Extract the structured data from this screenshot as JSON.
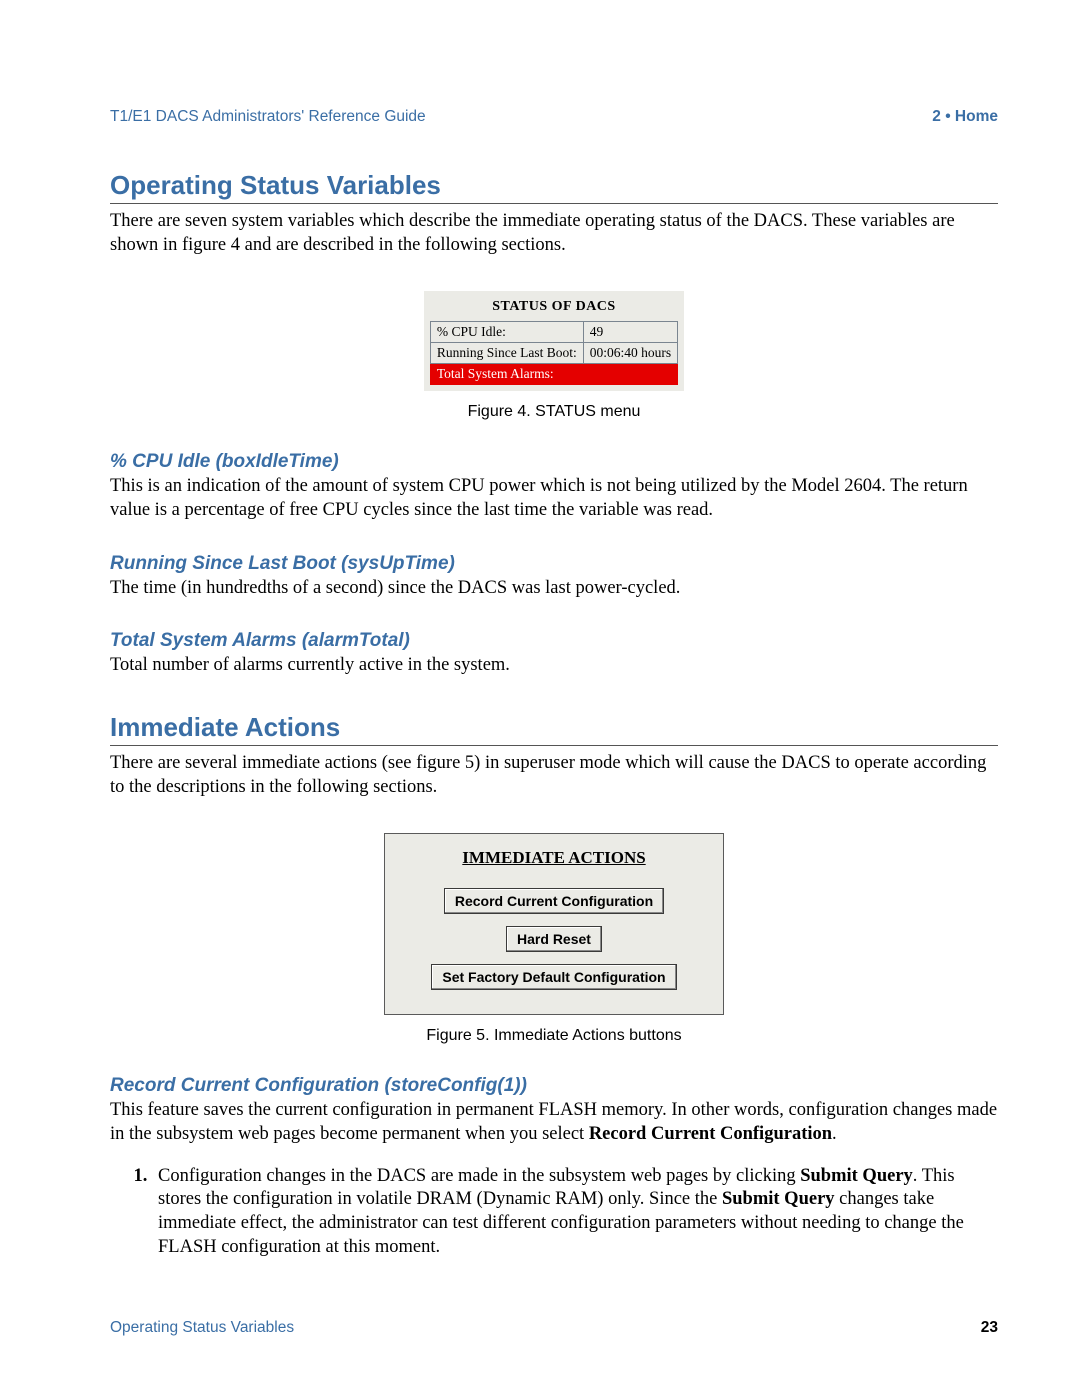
{
  "runhead": {
    "left": "T1/E1 DACS Administrators' Reference Guide",
    "right": "2 • Home"
  },
  "section1": {
    "title": "Operating Status Variables",
    "intro": "There are seven system variables which describe the immediate operating status of the DACS. These variables are shown in figure 4 and are described in the following sections."
  },
  "fig4": {
    "caption": "Figure 4. STATUS menu",
    "panel_title": "STATUS OF DACS",
    "rows": [
      {
        "label": "% CPU Idle:",
        "value": "49"
      },
      {
        "label": "Running Since Last Boot:",
        "value": "00:06:40 hours"
      },
      {
        "label": "Total System Alarms:",
        "value": ""
      }
    ]
  },
  "sub1": {
    "title": "% CPU Idle (boxIdleTime)",
    "body": "This is an indication of the amount of system CPU power which is not being utilized by the Model 2604. The return value is a percentage of free CPU cycles since the last time the variable was read."
  },
  "sub2": {
    "title": "Running Since Last Boot (sysUpTime)",
    "body": "The time (in hundredths of a second) since the DACS was last power-cycled."
  },
  "sub3": {
    "title": "Total System Alarms (alarmTotal)",
    "body": "Total number of alarms currently active in the system."
  },
  "section2": {
    "title": "Immediate Actions",
    "intro": "There are several immediate actions (see figure 5) in superuser mode which will cause the DACS to operate according to the descriptions in the following sections."
  },
  "fig5": {
    "caption": "Figure 5. Immediate Actions buttons",
    "panel_title": "IMMEDIATE ACTIONS",
    "buttons": [
      "Record Current Configuration",
      "Hard Reset",
      "Set Factory Default Configuration"
    ]
  },
  "sub4": {
    "title": "Record Current Configuration (storeConfig(1))",
    "body_pre": "This feature saves the current configuration in permanent FLASH memory. In other words, configuration changes made in the subsystem web pages become permanent when you select ",
    "body_bold": "Record Current Configuration",
    "body_post": "."
  },
  "list1": {
    "pre1": "Configuration changes in the DACS are made in the subsystem web pages by clicking ",
    "bold1": "Submit Query",
    "mid1": ". This stores the configuration in volatile DRAM (Dynamic RAM) only. Since the ",
    "bold2": "Submit Query",
    "post1": " changes take immediate effect, the administrator can test different configuration parameters without needing to change the FLASH configuration at this moment."
  },
  "footer": {
    "left": "Operating Status Variables",
    "right": "23"
  }
}
